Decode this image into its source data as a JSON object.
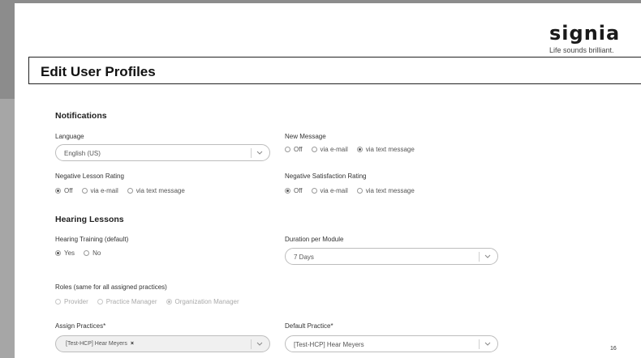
{
  "brand": {
    "logo": "signia",
    "tagline": "Life sounds brilliant."
  },
  "page": {
    "title": "Edit User Profiles",
    "number": "16"
  },
  "notifications": {
    "heading": "Notifications",
    "language": {
      "label": "Language",
      "value": "English (US)"
    },
    "new_message": {
      "label": "New Message",
      "options": [
        "Off",
        "via e-mail",
        "via text message"
      ],
      "selected": "via text message"
    },
    "negative_lesson_rating": {
      "label": "Negative Lesson Rating",
      "options": [
        "Off",
        "via e-mail",
        "via text message"
      ],
      "selected": "Off"
    },
    "negative_satisfaction_rating": {
      "label": "Negative Satisfaction Rating",
      "options": [
        "Off",
        "via e-mail",
        "via text message"
      ],
      "selected": "Off"
    }
  },
  "hearing_lessons": {
    "heading": "Hearing Lessons",
    "hearing_training": {
      "label": "Hearing Training (default)",
      "options": [
        "Yes",
        "No"
      ],
      "selected": "Yes"
    },
    "duration_per_module": {
      "label": "Duration per Module",
      "value": "7 Days"
    }
  },
  "roles": {
    "label": "Roles (same for all assigned practices)",
    "options": [
      "Provider",
      "Practice Manager",
      "Organization Manager"
    ],
    "selected": "Organization Manager"
  },
  "assign_practices": {
    "label": "Assign Practices*",
    "tag": "[Test-HCP] Hear Meyers",
    "remove_glyph": "×"
  },
  "default_practice": {
    "label": "Default Practice*",
    "value": "[Test-HCP] Hear Meyers"
  },
  "colors": {
    "frame": "#a6a6a6",
    "frame_dark": "#8c8c8c",
    "text": "#222222",
    "field_border": "#bdbdbd"
  },
  "icons": {
    "chevron": "chevron-down-icon",
    "remove": "close-icon"
  }
}
